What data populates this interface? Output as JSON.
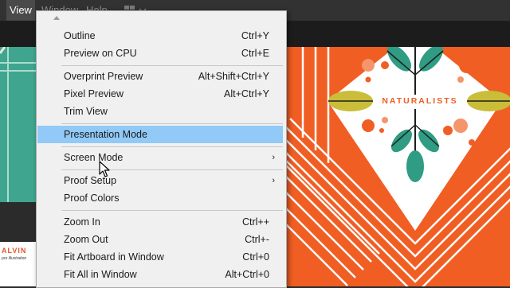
{
  "menubar": {
    "items": [
      "View",
      "Window",
      "Help"
    ],
    "active": "View"
  },
  "artwork": {
    "title": "NATURALISTS",
    "colors": {
      "orange": "#f05e23",
      "teal": "#2f9c83",
      "olive": "#c9bd3a",
      "peach": "#f4956b",
      "white": "#ffffff"
    }
  },
  "artboard_bottom": {
    "brand": "ALVIN",
    "tagline": "pro illustration"
  },
  "menu": {
    "items": [
      {
        "label": "Outline",
        "shortcut": "Ctrl+Y"
      },
      {
        "label": "Preview on CPU",
        "shortcut": "Ctrl+E"
      },
      {
        "label": "Overprint Preview",
        "shortcut": "Alt+Shift+Ctrl+Y"
      },
      {
        "label": "Pixel Preview",
        "shortcut": "Alt+Ctrl+Y"
      },
      {
        "label": "Trim View",
        "shortcut": ""
      },
      {
        "label": "Presentation Mode",
        "shortcut": ""
      },
      {
        "label": "Screen Mode",
        "shortcut": "",
        "submenu": "›"
      },
      {
        "label": "Proof Setup",
        "shortcut": "",
        "submenu": "›"
      },
      {
        "label": "Proof Colors",
        "shortcut": ""
      },
      {
        "label": "Zoom In",
        "shortcut": "Ctrl++"
      },
      {
        "label": "Zoom Out",
        "shortcut": "Ctrl+-"
      },
      {
        "label": "Fit Artboard in Window",
        "shortcut": "Ctrl+0"
      },
      {
        "label": "Fit All in Window",
        "shortcut": "Alt+Ctrl+0"
      }
    ]
  },
  "icons": {
    "scroll_up": "triangle-up-icon",
    "submenu": "chevron-right-icon",
    "cursor": "mouse-pointer-icon",
    "arrange": "arrange-documents-icon"
  }
}
